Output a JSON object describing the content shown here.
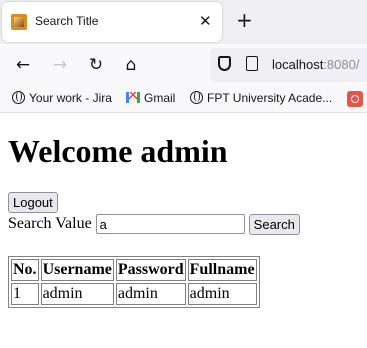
{
  "browser": {
    "tab_title": "Search Title",
    "tab_close": "✕",
    "new_tab": "+",
    "url_host": "localhost",
    "url_port": ":8080/",
    "bookmarks": [
      {
        "icon": "globe-icon",
        "label": "Your work - Jira"
      },
      {
        "icon": "gmail-icon",
        "label": "Gmail"
      },
      {
        "icon": "globe-icon",
        "label": "FPT University Acade..."
      }
    ]
  },
  "page": {
    "heading": "Welcome admin",
    "logout_label": "Logout",
    "search_label": "Search Value",
    "search_value": "a",
    "search_button": "Search",
    "table": {
      "headers": [
        "No.",
        "Username",
        "Password",
        "Fullname"
      ],
      "rows": [
        [
          "1",
          "admin",
          "admin",
          "admin"
        ]
      ]
    }
  }
}
